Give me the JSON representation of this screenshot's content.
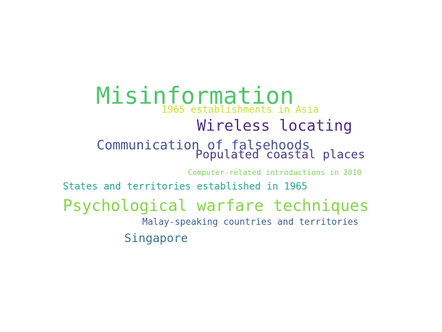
{
  "words": [
    {
      "text": "Misinformation",
      "color": "#4fc36a"
    },
    {
      "text": "1965 establishments in Asia",
      "color": "#c9df2f"
    },
    {
      "text": "Wireless locating",
      "color": "#4b2d7f"
    },
    {
      "text": "Communication of falsehoods",
      "color": "#424f8f"
    },
    {
      "text": "Populated coastal places",
      "color": "#463480"
    },
    {
      "text": "Computer-related introductions in 2010",
      "color": "#7fd35a"
    },
    {
      "text": "States and territories established in 1965",
      "color": "#24a38a"
    },
    {
      "text": "Psychological warfare techniques",
      "color": "#86d449"
    },
    {
      "text": "Malay-speaking countries and territories",
      "color": "#3b5c8d"
    },
    {
      "text": "Singapore",
      "color": "#386f8e"
    }
  ]
}
